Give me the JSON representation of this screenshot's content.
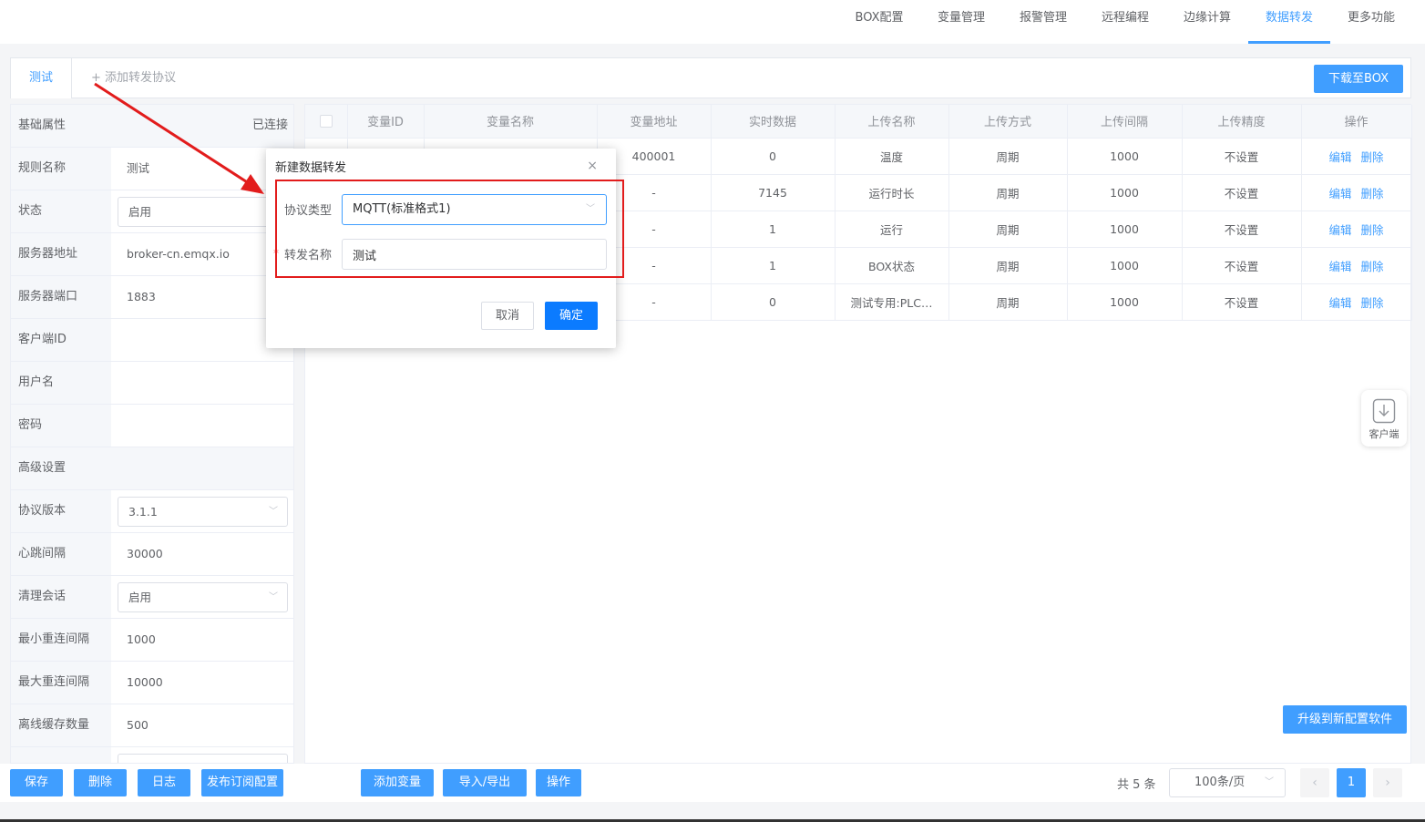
{
  "topnav": {
    "tabs": [
      {
        "label": "BOX配置",
        "active": false
      },
      {
        "label": "变量管理",
        "active": false
      },
      {
        "label": "报警管理",
        "active": false
      },
      {
        "label": "远程编程",
        "active": false
      },
      {
        "label": "边缘计算",
        "active": false
      },
      {
        "label": "数据转发",
        "active": true
      },
      {
        "label": "更多功能",
        "active": false
      }
    ]
  },
  "protocols": {
    "active_tab": "测试",
    "add_label": "+ 添加转发协议",
    "download_label": "下载至BOX"
  },
  "left_panel": {
    "basic_section": "基础属性",
    "connection_status": "已连接",
    "rule_name_label": "规则名称",
    "rule_name_value": "测试",
    "state_label": "状态",
    "state_value": "启用",
    "server_addr_label": "服务器地址",
    "server_addr_value": "broker-cn.emqx.io",
    "server_port_label": "服务器端口",
    "server_port_value": "1883",
    "client_id_label": "客户端ID",
    "client_id_value": "",
    "username_label": "用户名",
    "username_value": "",
    "password_label": "密码",
    "password_value": "",
    "advanced_section": "高级设置",
    "proto_version_label": "协议版本",
    "proto_version_value": "3.1.1",
    "heartbeat_label": "心跳间隔",
    "heartbeat_value": "30000",
    "clean_session_label": "清理会话",
    "clean_session_value": "启用",
    "min_reconnect_label": "最小重连间隔",
    "min_reconnect_value": "1000",
    "max_reconnect_label": "最大重连间隔",
    "max_reconnect_value": "10000",
    "offline_cache_label": "离线缓存数量",
    "offline_cache_value": "500"
  },
  "table": {
    "headers": [
      "变量ID",
      "变量名称",
      "变量地址",
      "实时数据",
      "上传名称",
      "上传方式",
      "上传间隔",
      "上传精度",
      "操作"
    ],
    "rows": [
      {
        "id": "",
        "name": "",
        "addr": "400001",
        "data": "0",
        "upname": "温度",
        "mode": "周期",
        "interval": "1000",
        "precision": "不设置"
      },
      {
        "id": "",
        "name": "",
        "addr": "-",
        "data": "7145",
        "upname": "运行时长",
        "mode": "周期",
        "interval": "1000",
        "precision": "不设置"
      },
      {
        "id": "",
        "name": "",
        "addr": "-",
        "data": "1",
        "upname": "运行",
        "mode": "周期",
        "interval": "1000",
        "precision": "不设置"
      },
      {
        "id": "",
        "name": "",
        "addr": "-",
        "data": "1",
        "upname": "BOX状态",
        "mode": "周期",
        "interval": "1000",
        "precision": "不设置"
      },
      {
        "id": "",
        "name": "",
        "addr": "-",
        "data": "0",
        "upname": "测试专用:PLC…",
        "mode": "周期",
        "interval": "1000",
        "precision": "不设置"
      }
    ],
    "edit_label": "编辑",
    "delete_label": "删除"
  },
  "upgrade_label": "升级到新配置软件",
  "client_float_label": "客户端",
  "bottom": {
    "save": "保存",
    "delete": "删除",
    "log": "日志",
    "publish": "发布订阅配置",
    "add_var": "添加变量",
    "import_export": "导入/导出",
    "operate": "操作",
    "total": "共 5 条",
    "page_size": "100条/页",
    "page": "1"
  },
  "modal": {
    "title": "新建数据转发",
    "close": "×",
    "type_label": "协议类型",
    "type_value": "MQTT(标准格式1)",
    "name_label": "转发名称",
    "name_value": "测试",
    "required_mark": "*",
    "cancel": "取消",
    "ok": "确定"
  },
  "colors": {
    "primary": "#409eff",
    "annotation_red": "#e21c1c"
  }
}
